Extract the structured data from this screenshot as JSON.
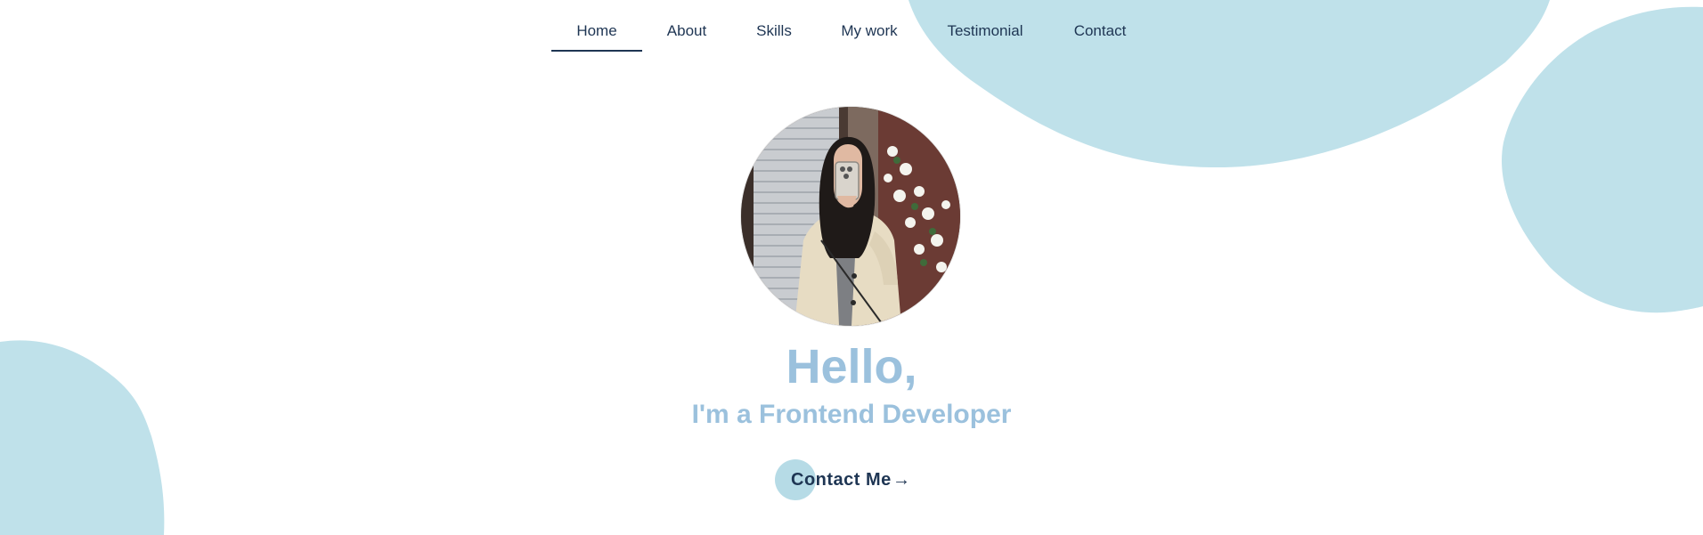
{
  "nav": {
    "items": [
      {
        "label": "Home",
        "active": true
      },
      {
        "label": "About",
        "active": false
      },
      {
        "label": "Skills",
        "active": false
      },
      {
        "label": "My work",
        "active": false
      },
      {
        "label": "Testimonial",
        "active": false
      },
      {
        "label": "Contact",
        "active": false
      }
    ]
  },
  "hero": {
    "greeting": "Hello,",
    "subtitle": "I'm a Frontend Developer",
    "cta_label": "Contact Me",
    "cta_arrow": "→"
  },
  "colors": {
    "blob": "#bfe1ea",
    "heading": "#9bc1dd",
    "nav_text": "#1e3553",
    "cta_circle": "#b6dbe6"
  },
  "icons": {
    "cta_arrow": "arrow-right-icon",
    "avatar": "profile-photo"
  }
}
